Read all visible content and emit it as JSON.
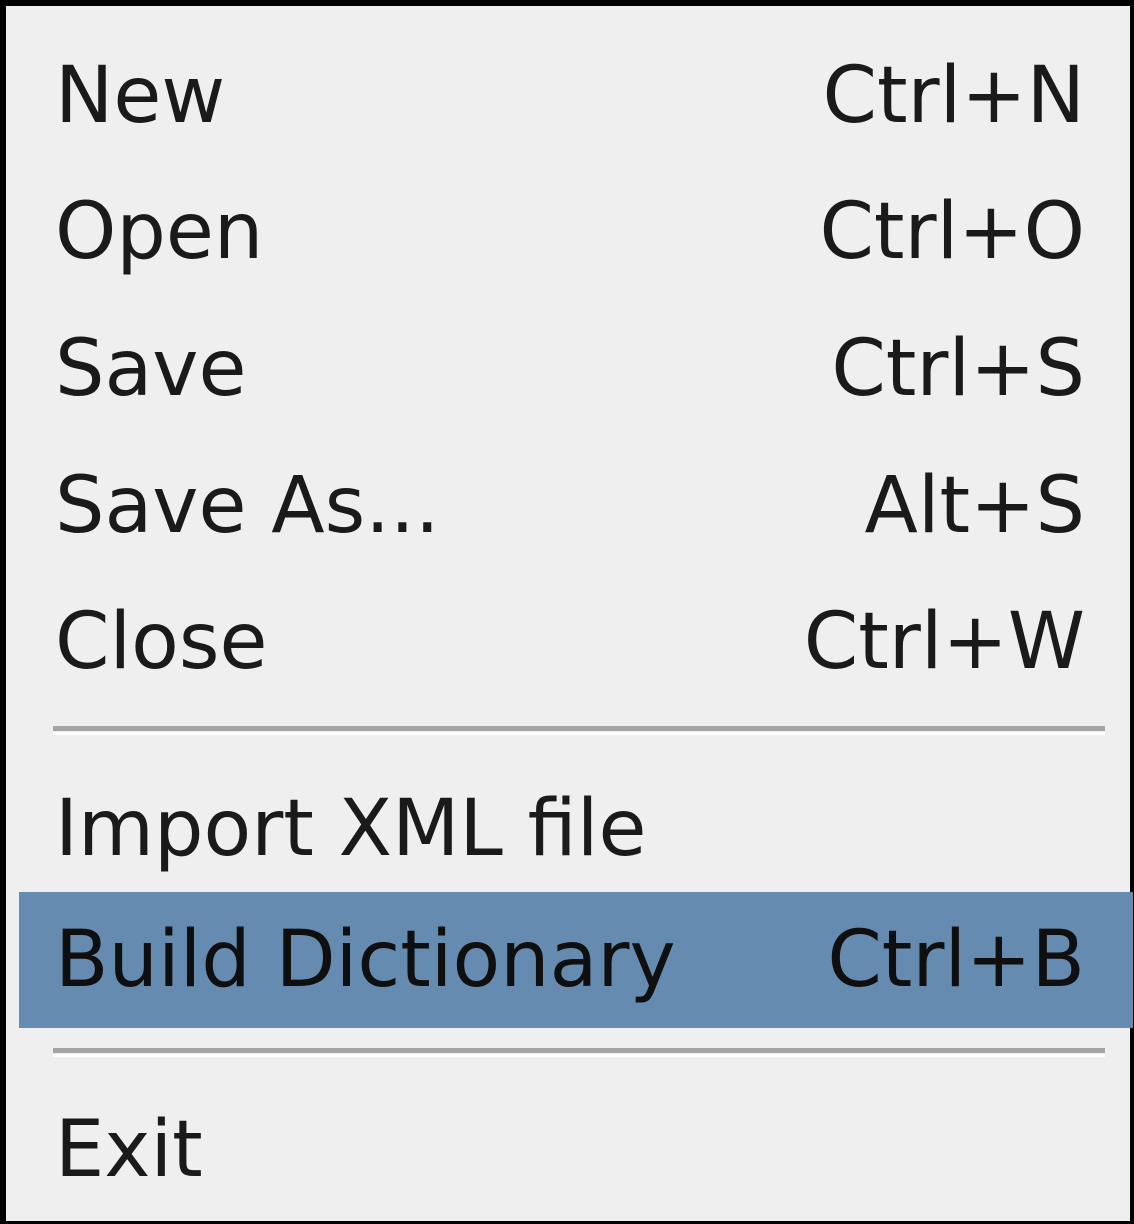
{
  "menu": {
    "items": [
      {
        "label": "New",
        "shortcut": "Ctrl+N"
      },
      {
        "label": "Open",
        "shortcut": "Ctrl+O"
      },
      {
        "label": "Save",
        "shortcut": "Ctrl+S"
      },
      {
        "label": "Save As...",
        "shortcut": "Alt+S"
      },
      {
        "label": "Close",
        "shortcut": "Ctrl+W"
      },
      {
        "label": "Import XML file",
        "shortcut": ""
      },
      {
        "label": "Build Dictionary",
        "shortcut": "Ctrl+B"
      },
      {
        "label": "Exit",
        "shortcut": ""
      }
    ],
    "highlighted_item": "Build Dictionary",
    "colors": {
      "background": "#efefef",
      "highlight": "#668bb0",
      "border": "#000000",
      "separator": "#a4a4a4"
    }
  }
}
